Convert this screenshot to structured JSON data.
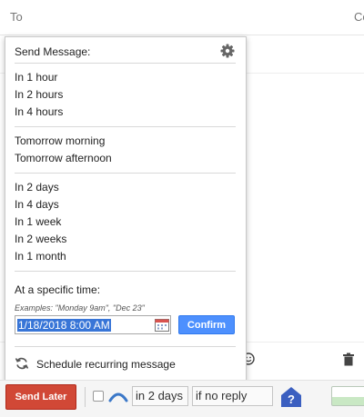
{
  "compose": {
    "to_label": "To",
    "cc_label": "Cc"
  },
  "popup": {
    "title": "Send Message:",
    "quick_options": [
      "In 1 hour",
      "In 2 hours",
      "In 4 hours"
    ],
    "day_options": [
      "Tomorrow morning",
      "Tomorrow afternoon"
    ],
    "later_options": [
      "In 2 days",
      "In 4 days",
      "In 1 week",
      "In 2 weeks",
      "In 1 month"
    ],
    "specific_label": "At a specific time:",
    "examples": "Examples: \"Monday 9am\", \"Dec 23\"",
    "datetime_value": "1/18/2018 8:00 AM",
    "confirm_label": "Confirm",
    "recurring_label": "Schedule recurring message"
  },
  "bottom_bar": {
    "send_later_label": "Send Later",
    "followup_delay": "in 2 days",
    "followup_condition": "if no reply"
  },
  "icons": {
    "gear": "gear-icon",
    "calendar": "calendar-icon",
    "recurring": "refresh-icon",
    "emoji": "emoji-icon",
    "trash": "trash-icon",
    "caret": "caret-up-icon",
    "help": "help-icon"
  },
  "colors": {
    "send_later": "#d14836",
    "confirm": "#4d90fe",
    "selection": "#3875d7",
    "followup_caret": "#3b78c8",
    "help_icon": "#3b5fc0"
  }
}
